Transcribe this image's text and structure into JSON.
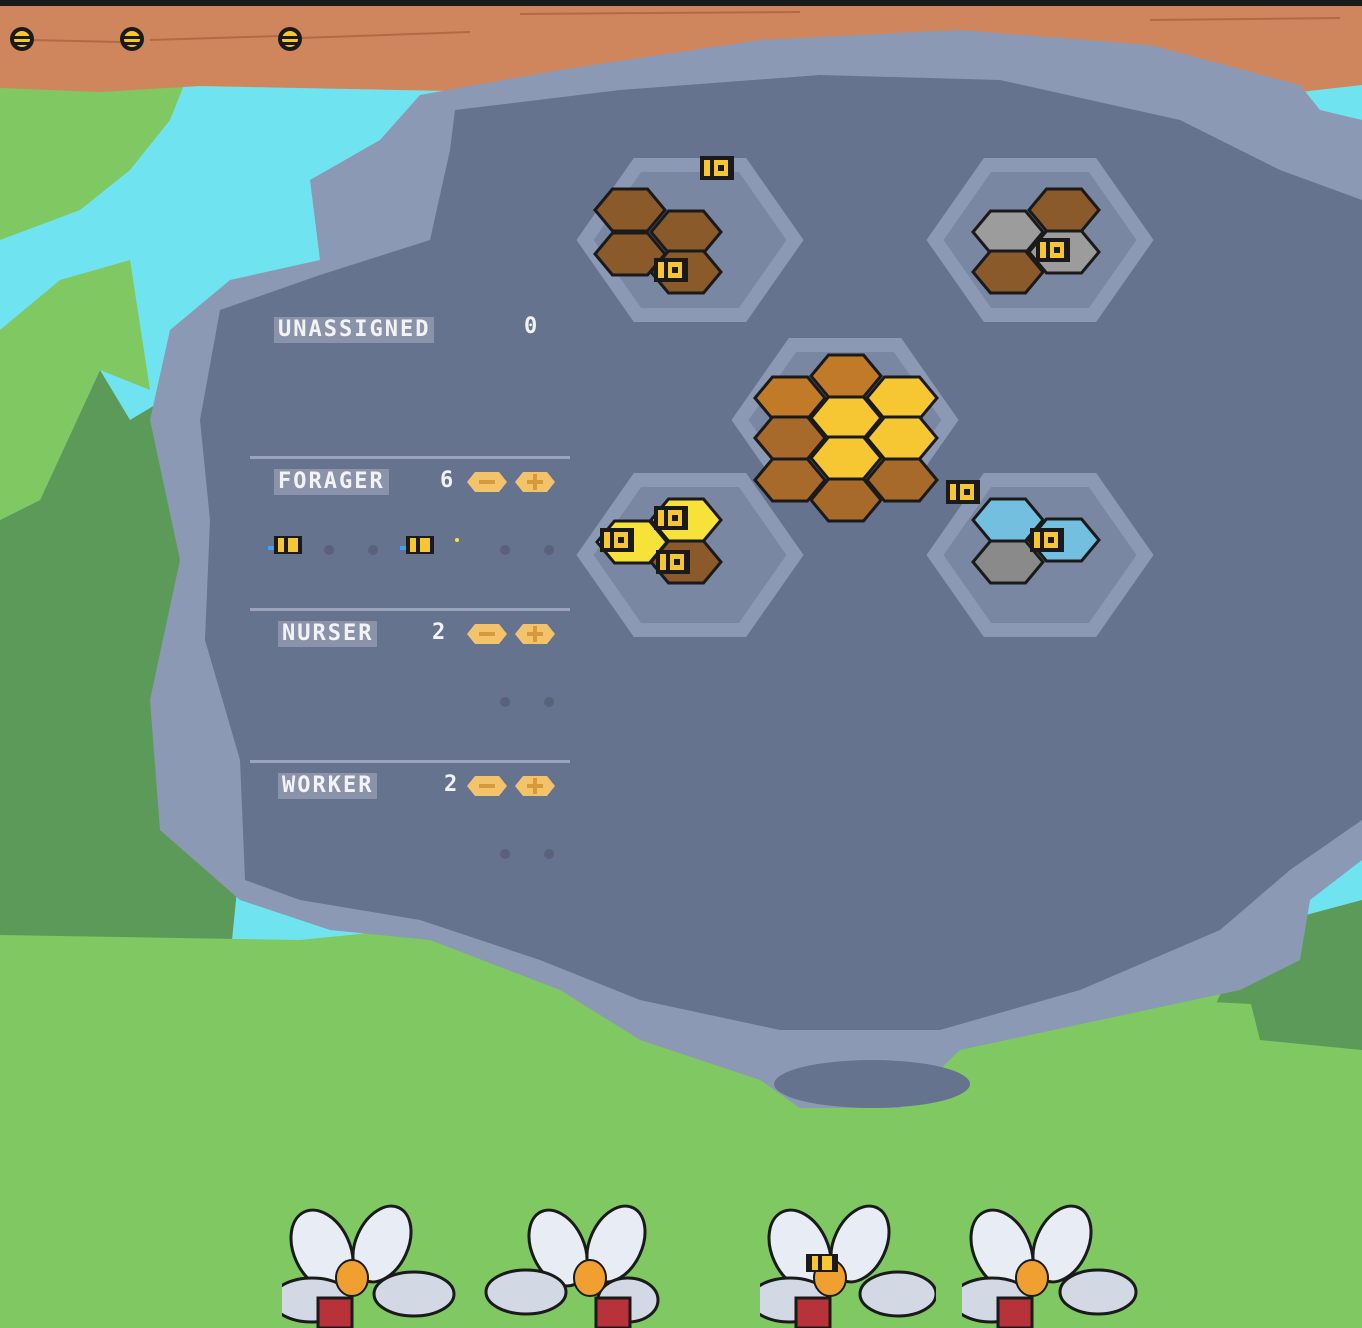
{
  "hud": {
    "bee_lives": [
      "bee-icon",
      "bee-icon",
      "bee-icon"
    ]
  },
  "roles": [
    {
      "key": "unassigned",
      "label": "UNASSIGNED",
      "count": "0"
    },
    {
      "key": "forager",
      "label": "FORAGER",
      "count": "6",
      "decrease_icon": "comb-minus-icon",
      "increase_icon": "comb-plus-icon"
    },
    {
      "key": "nurser",
      "label": "NURSER",
      "count": "2",
      "decrease_icon": "comb-minus-icon",
      "increase_icon": "comb-plus-icon"
    },
    {
      "key": "worker",
      "label": "WORKER",
      "count": "2",
      "decrease_icon": "comb-minus-icon",
      "increase_icon": "comb-plus-icon"
    }
  ],
  "hive": {
    "center": "honey-storage-cells",
    "top_left": "brood-cells",
    "top_right": "wax-building-cells",
    "bottom_left": "pollen-cells",
    "bottom_right": "water-cells"
  },
  "flowers": [
    "flower-icon",
    "flower-icon",
    "flower-icon",
    "flower-icon"
  ],
  "colors": {
    "sky": "#6fe3ef",
    "branch": "#d0865c",
    "grass": "#7fc862",
    "tree": "#5b9a58",
    "hive_shell": "#8c99b4",
    "hive_inner": "#66738f",
    "honey": "#f6c733",
    "brood": "#8b5a2b",
    "water": "#73bfe0",
    "wax": "#9c9c9c"
  }
}
